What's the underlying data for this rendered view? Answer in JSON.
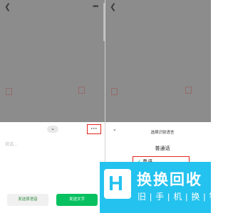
{
  "left": {
    "back_icon": "chevron-left-icon",
    "more_icon": "dots-icon",
    "sheet": {
      "chevron_icon": "chevron-down-icon",
      "more_label": "···",
      "placeholder": "说话...",
      "voice_button": "发送原语音",
      "text_button": "发送文字"
    }
  },
  "right": {
    "back_icon": "chevron-left-icon",
    "panel": {
      "close_icon": "chevron-down-icon",
      "title": "选择识别语言",
      "option_mandarin": "普通话",
      "option_cantonese": "粤语",
      "check_icon": "checkmark-icon"
    }
  },
  "watermark": {
    "title": "换换回收",
    "subtitle": "旧|手|机|换|钱",
    "brand_color": "#24c2ef"
  }
}
